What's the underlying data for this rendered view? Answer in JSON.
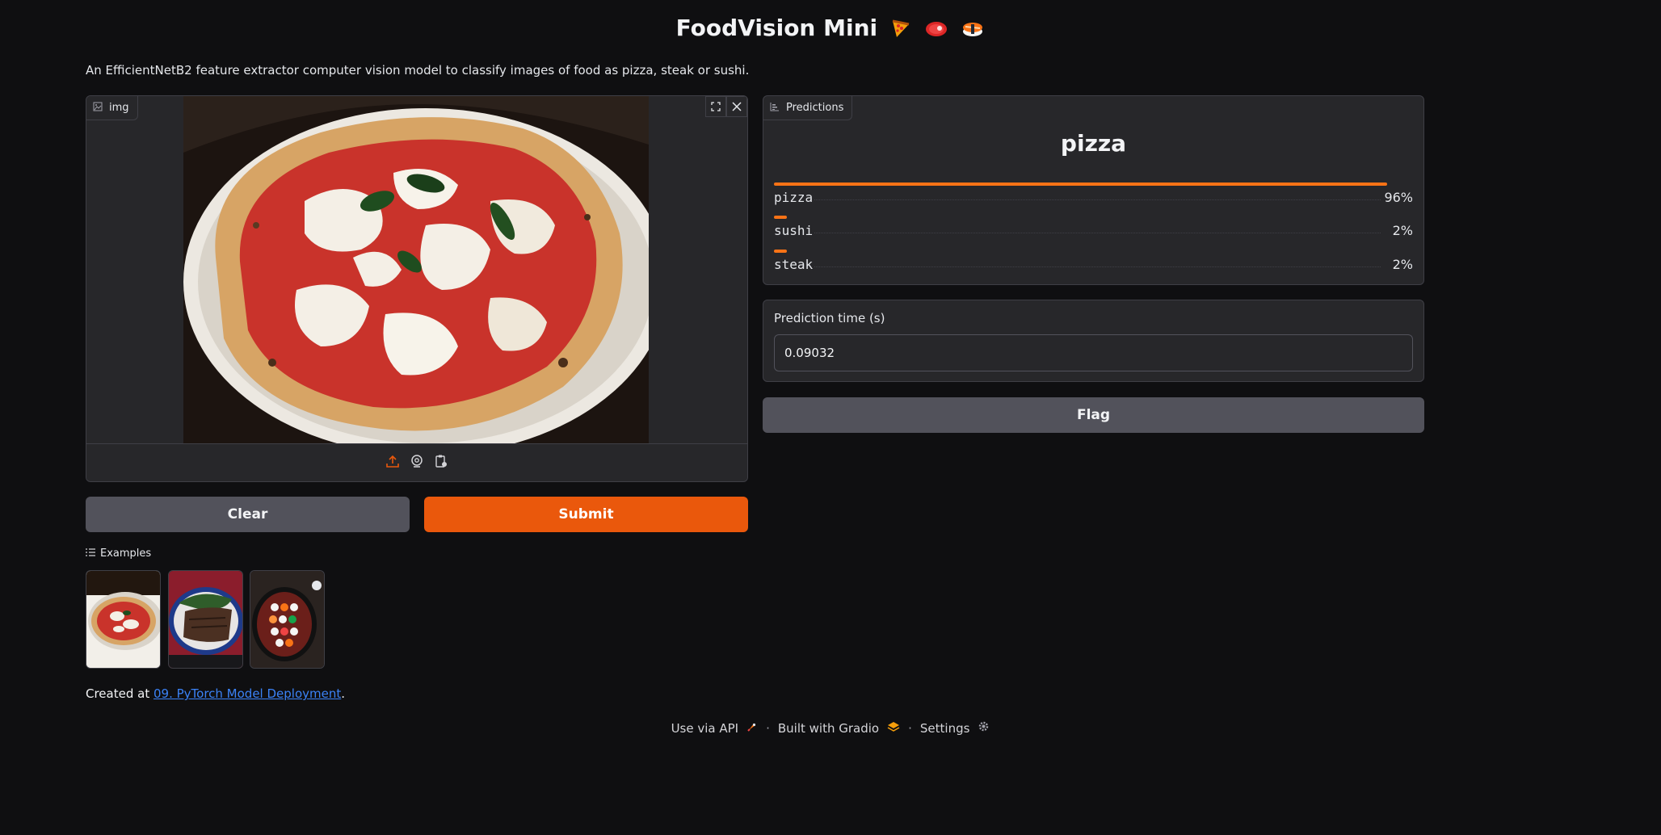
{
  "app": {
    "title": "FoodVision Mini",
    "title_emojis": [
      "pizza-icon",
      "steak-icon",
      "sushi-icon"
    ],
    "description": "An EfficientNetB2 feature extractor computer vision model to classify images of food as pizza, steak or sushi."
  },
  "input_image": {
    "label": "img",
    "icon": "image-icon",
    "tools": [
      "fullscreen-icon",
      "close-icon"
    ],
    "sources": [
      "upload-icon",
      "webcam-icon",
      "clipboard-icon"
    ]
  },
  "buttons": {
    "clear": "Clear",
    "submit": "Submit",
    "flag": "Flag"
  },
  "predictions": {
    "label": "Predictions",
    "icon": "bar-chart-icon",
    "top_label": "pizza",
    "confidences": [
      {
        "name": "pizza",
        "value": 0.96,
        "display": "96%"
      },
      {
        "name": "sushi",
        "value": 0.02,
        "display": "2%"
      },
      {
        "name": "steak",
        "value": 0.02,
        "display": "2%"
      }
    ]
  },
  "prediction_time": {
    "label": "Prediction time (s)",
    "value": "0.09032"
  },
  "examples": {
    "label": "Examples",
    "items": [
      "pizza-example",
      "steak-example",
      "sushi-example"
    ]
  },
  "created": {
    "prefix": "Created at ",
    "link_text": "09. PyTorch Model Deployment",
    "suffix": "."
  },
  "footer": {
    "api": "Use via API",
    "built": "Built with Gradio",
    "settings": "Settings",
    "separator": "·"
  },
  "colors": {
    "background": "#0f0f11",
    "panel": "#27272a",
    "accent": "#ea580c",
    "bar": "#f97316",
    "link": "#3b82f6"
  }
}
